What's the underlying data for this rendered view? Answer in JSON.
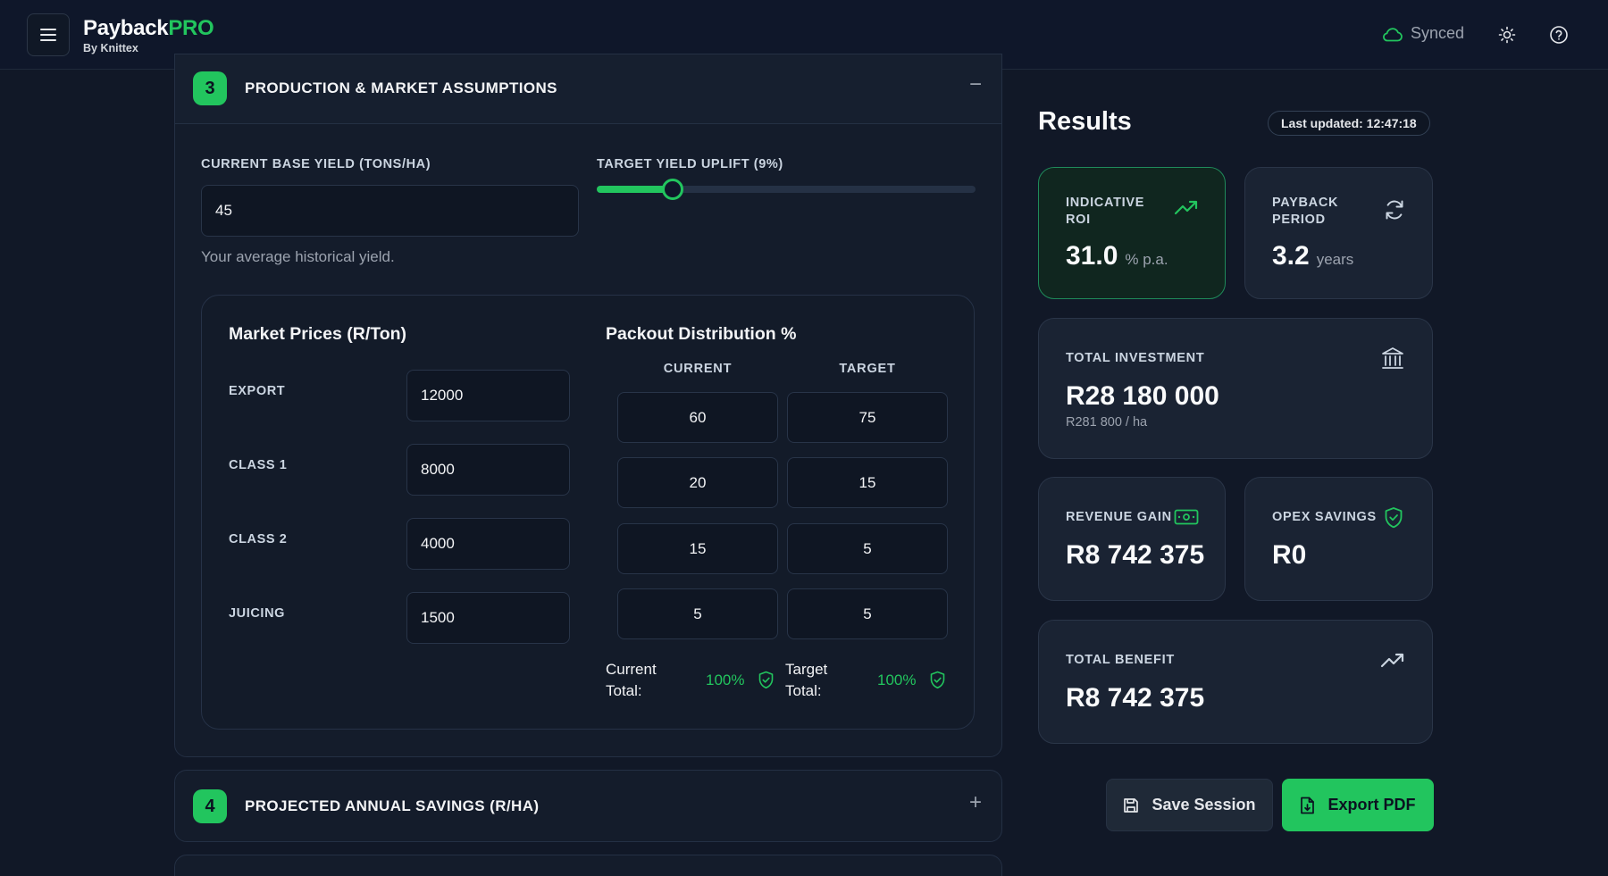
{
  "brand": {
    "name": "Payback",
    "suffix": "PRO",
    "sub": "By Knittex"
  },
  "topbar": {
    "sync_status": "Synced",
    "menu_icon": "menu-icon",
    "theme_icon": "sun-icon",
    "help_icon": "help-icon"
  },
  "section3": {
    "step": "3",
    "title": "PRODUCTION & MARKET ASSUMPTIONS",
    "toggle": "−",
    "base_yield_label": "CURRENT BASE YIELD (TONS/HA)",
    "base_yield_value": "45",
    "base_yield_hint": "Your average historical yield.",
    "uplift_label": "TARGET YIELD UPLIFT (9%)",
    "uplift_fraction": 0.2,
    "market_title": "Market Prices (R/Ton)",
    "prices": [
      {
        "label": "EXPORT",
        "value": "12000"
      },
      {
        "label": "CLASS 1",
        "value": "8000"
      },
      {
        "label": "CLASS 2",
        "value": "4000"
      },
      {
        "label": "JUICING",
        "value": "1500"
      }
    ],
    "packout_title": "Packout Distribution %",
    "col_current": "CURRENT",
    "col_target": "TARGET",
    "packout": [
      {
        "current": "60",
        "target": "75"
      },
      {
        "current": "20",
        "target": "15"
      },
      {
        "current": "15",
        "target": "5"
      },
      {
        "current": "5",
        "target": "5"
      }
    ],
    "current_total_label": "Current Total:",
    "current_total_value": "100%",
    "target_total_label": "Target Total:",
    "target_total_value": "100%"
  },
  "section4": {
    "step": "4",
    "title": "PROJECTED ANNUAL SAVINGS (R/HA)",
    "toggle": "+"
  },
  "results": {
    "title": "Results",
    "last_updated": "Last updated: 12:47:18",
    "roi_label_1": "INDICATIVE",
    "roi_label_2": "ROI",
    "roi_value": "31.0",
    "roi_unit": "% p.a.",
    "payback_label_1": "PAYBACK",
    "payback_label_2": "PERIOD",
    "payback_value": "3.2",
    "payback_unit": "years",
    "investment_label": "TOTAL INVESTMENT",
    "investment_value": "R28 180 000",
    "investment_sub": "R281 800 / ha",
    "revenue_label": "REVENUE GAIN",
    "revenue_value": "R8 742 375",
    "opex_label": "OPEX SAVINGS",
    "opex_value": "R0",
    "benefit_label": "TOTAL BENEFIT",
    "benefit_value": "R8 742 375"
  },
  "actions": {
    "save_label": "Save Session",
    "export_label": "Export PDF"
  },
  "colors": {
    "accent": "#22c55e",
    "background": "#111827",
    "card": "#1a2333"
  }
}
